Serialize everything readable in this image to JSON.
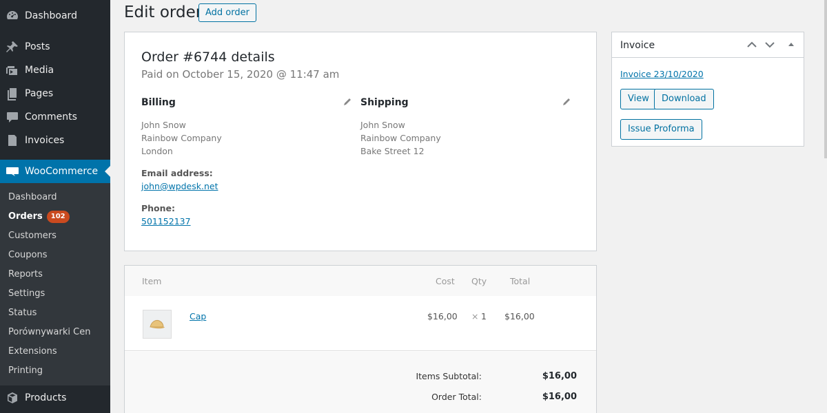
{
  "sidebar": {
    "top_items": [
      {
        "label": "Dashboard",
        "icon": "dashboard-icon"
      },
      {
        "label": "Posts",
        "icon": "pin-icon"
      },
      {
        "label": "Media",
        "icon": "media-icon"
      },
      {
        "label": "Pages",
        "icon": "pages-icon"
      },
      {
        "label": "Comments",
        "icon": "comments-icon"
      },
      {
        "label": "Invoices",
        "icon": "invoices-icon"
      }
    ],
    "woocommerce": {
      "label": "WooCommerce",
      "icon": "woocommerce-icon"
    },
    "submenu": [
      {
        "label": "Dashboard"
      },
      {
        "label": "Orders",
        "badge": "102"
      },
      {
        "label": "Customers"
      },
      {
        "label": "Coupons"
      },
      {
        "label": "Reports"
      },
      {
        "label": "Settings"
      },
      {
        "label": "Status"
      },
      {
        "label": "Porównywarki Cen"
      },
      {
        "label": "Extensions"
      },
      {
        "label": "Printing"
      }
    ],
    "products": {
      "label": "Products",
      "icon": "products-icon"
    }
  },
  "header": {
    "title": "Edit order",
    "add_button": "Add order"
  },
  "order": {
    "heading": "Order #6744 details",
    "paid": "Paid on October 15, 2020 @ 11:47 am",
    "billing": {
      "title": "Billing",
      "lines": [
        "John Snow",
        "Rainbow Company",
        "London"
      ],
      "email_label": "Email address:",
      "email": "john@wpdesk.net",
      "phone_label": "Phone:",
      "phone": "501152137"
    },
    "shipping": {
      "title": "Shipping",
      "lines": [
        "John Snow",
        "Rainbow Company",
        "Bake Street 12"
      ]
    }
  },
  "items": {
    "headers": {
      "item": "Item",
      "cost": "Cost",
      "qty": "Qty",
      "total": "Total"
    },
    "rows": [
      {
        "name": "Cap",
        "cost": "$16,00",
        "qty_x": "×",
        "qty": "1",
        "total": "$16,00"
      }
    ],
    "subtotal_label": "Items Subtotal:",
    "subtotal": "$16,00",
    "total_label": "Order Total:",
    "total": "$16,00"
  },
  "invoice": {
    "title": "Invoice",
    "link": "Invoice 23/10/2020",
    "view": "View",
    "download": "Download",
    "proforma": "Issue Proforma"
  },
  "colors": {
    "sidebar_bg": "#23282d",
    "submenu_bg": "#32373c",
    "accent": "#0073aa",
    "badge": "#ca4a1f"
  }
}
